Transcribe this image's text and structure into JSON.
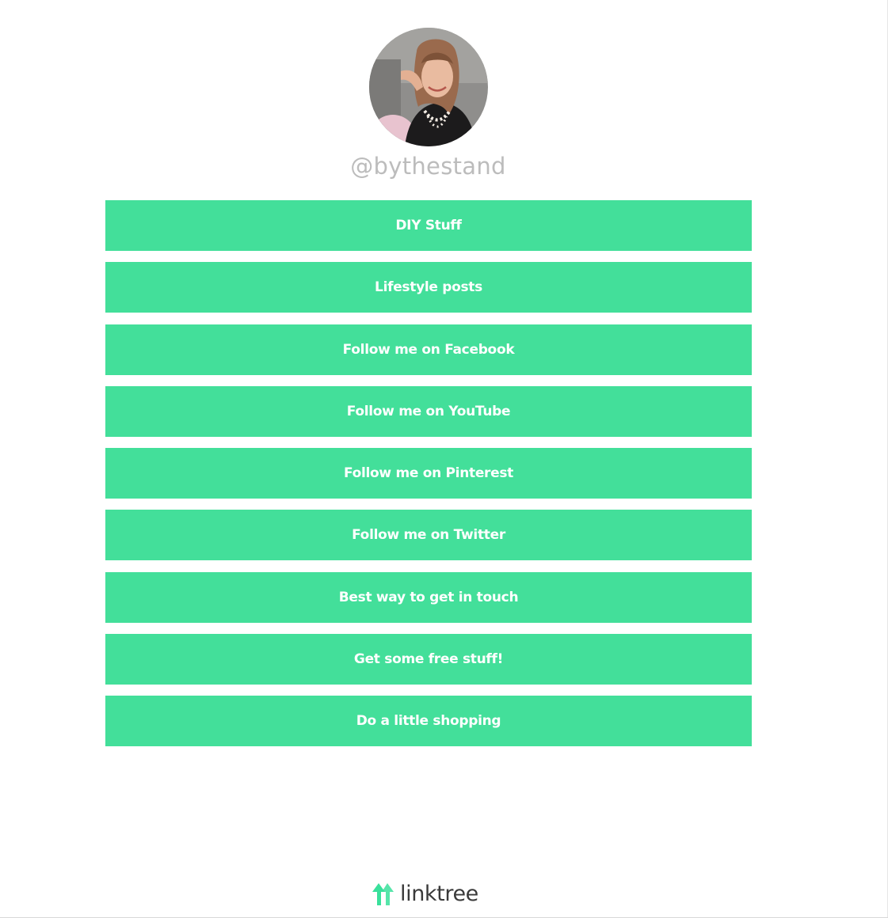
{
  "profile": {
    "username": "@bythestand"
  },
  "links": [
    {
      "label": "DIY Stuff"
    },
    {
      "label": "Lifestyle posts"
    },
    {
      "label": "Follow me on Facebook"
    },
    {
      "label": "Follow me on YouTube"
    },
    {
      "label": "Follow me on Pinterest"
    },
    {
      "label": "Follow me on Twitter"
    },
    {
      "label": "Best way to get in touch"
    },
    {
      "label": "Get some free stuff!"
    },
    {
      "label": "Do a little shopping"
    }
  ],
  "footer": {
    "brand": "linktree",
    "icon": "linktree-logo-icon"
  },
  "colors": {
    "button": "#43df9a",
    "button_text": "#ffffff",
    "username": "#bcbcbc",
    "background": "#ffffff"
  }
}
